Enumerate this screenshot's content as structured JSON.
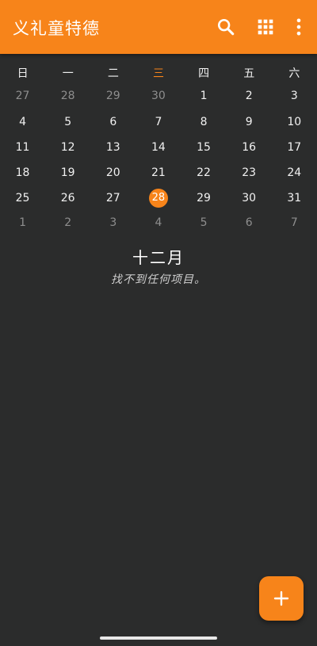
{
  "app_bar": {
    "title": "义礼童特德",
    "background": "#f7841a",
    "icons": [
      "search-icon",
      "grid-view-icon",
      "more-vert-icon"
    ]
  },
  "calendar": {
    "weekdays": [
      "日",
      "一",
      "二",
      "三",
      "四",
      "五",
      "六"
    ],
    "current_weekday_index": 3,
    "weeks": [
      [
        "27",
        "28",
        "29",
        "30",
        "1",
        "2",
        "3"
      ],
      [
        "4",
        "5",
        "6",
        "7",
        "8",
        "9",
        "10"
      ],
      [
        "11",
        "12",
        "13",
        "14",
        "15",
        "16",
        "17"
      ],
      [
        "18",
        "19",
        "20",
        "21",
        "22",
        "23",
        "24"
      ],
      [
        "25",
        "26",
        "27",
        "28",
        "29",
        "30",
        "31"
      ],
      [
        "1",
        "2",
        "3",
        "4",
        "5",
        "6",
        "7"
      ]
    ],
    "today": "28",
    "accent": "#f7841a"
  },
  "main": {
    "month_title": "十二月",
    "empty_text": "找不到任何项目。"
  },
  "fab": {
    "icon": "plus-icon"
  }
}
